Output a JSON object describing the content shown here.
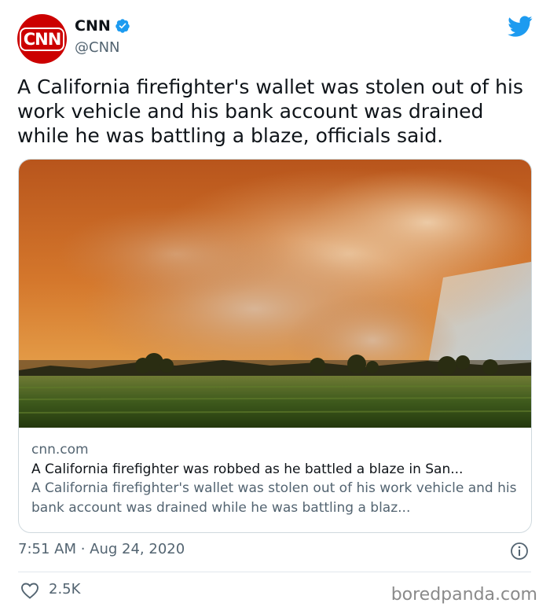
{
  "author": {
    "avatar_text": "CNN",
    "name": "CNN",
    "handle": "@CNN",
    "verified_icon": "verified-badge-icon",
    "brand_color": "#cc0000"
  },
  "platform_icon": "twitter-bird-icon",
  "tweet": {
    "text": "A California firefighter's wallet was stolen out of his work vehicle and his bank account was drained while he was battling a blaze, officials said."
  },
  "link_card": {
    "domain": "cnn.com",
    "title": "A California firefighter was robbed as he battled a blaze in San...",
    "description": "A California firefighter's wallet was stolen out of his work vehicle and his bank account was drained while he was battling a blaz..."
  },
  "meta": {
    "timestamp": "7:51 AM · Aug 24, 2020",
    "likes": "2.5K"
  },
  "watermark": "boredpanda.com",
  "colors": {
    "twitter_blue": "#1d9bf0",
    "secondary_text": "#536471"
  }
}
